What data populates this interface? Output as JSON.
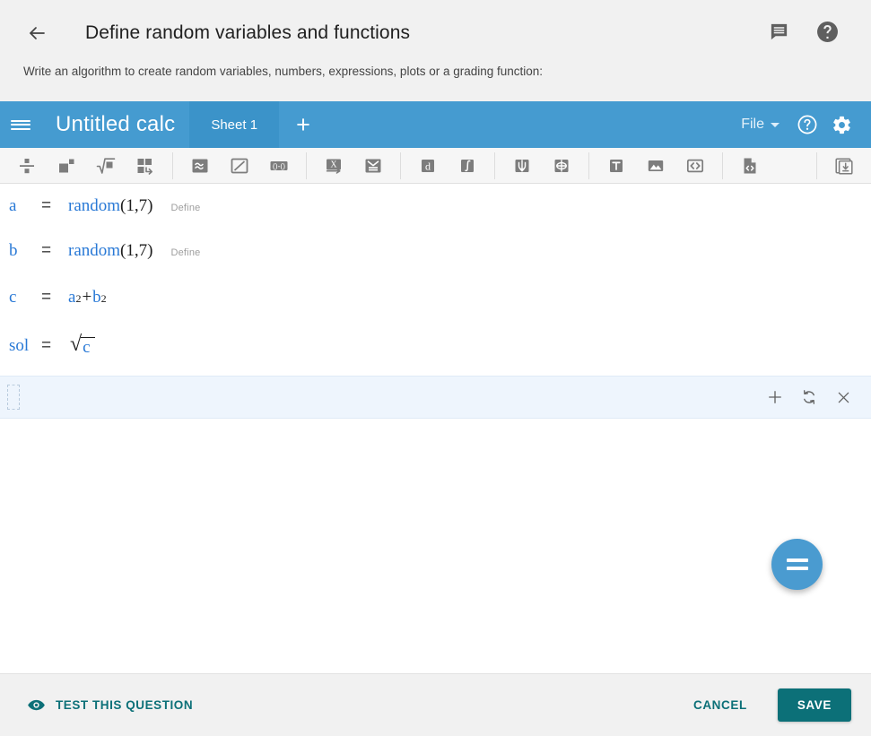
{
  "header": {
    "back_icon": "arrow-left-icon",
    "title": "Define random variables and functions",
    "subtitle": "Write an algorithm to create random variables, numbers, expressions, plots or a grading function:",
    "actions": [
      {
        "icon": "comment-icon",
        "name": "comment-icon"
      },
      {
        "icon": "help-circle-icon",
        "name": "help-icon"
      }
    ]
  },
  "appbar": {
    "menu_icon": "hamburger-menu-icon",
    "calc_title": "Untitled calc",
    "tabs": [
      {
        "label": "Sheet 1",
        "active": true
      }
    ],
    "add_tab_label": "+",
    "file_menu_label": "File",
    "help_icon": "help-circle-icon",
    "settings_icon": "gear-icon",
    "bg_color": "#459bd0",
    "active_tab_color": "#3b93c9"
  },
  "toolbar": {
    "groups": [
      {
        "buttons": [
          {
            "name": "fraction-icon",
            "title": "Fraction"
          },
          {
            "name": "exponent-icon",
            "title": "Exponent"
          },
          {
            "name": "square-root-icon",
            "title": "Square root"
          },
          {
            "name": "matrix-icon",
            "title": "Matrix"
          }
        ]
      },
      {
        "buttons": [
          {
            "name": "approx-equal-icon",
            "title": "Approximately equal"
          },
          {
            "name": "not-equal-icon",
            "title": "Not equal"
          },
          {
            "name": "interval-icon",
            "title": "Interval"
          }
        ]
      },
      {
        "buttons": [
          {
            "name": "substitute-icon",
            "title": "Substitute"
          },
          {
            "name": "system-equations-icon",
            "title": "System of equations"
          }
        ]
      },
      {
        "buttons": [
          {
            "name": "derivative-icon",
            "title": "Derivative"
          },
          {
            "name": "integral-icon",
            "title": "Integral"
          }
        ]
      },
      {
        "buttons": [
          {
            "name": "units-icon",
            "title": "Units"
          },
          {
            "name": "plot-units-icon",
            "title": "Plot"
          }
        ]
      },
      {
        "buttons": [
          {
            "name": "text-icon",
            "title": "Text"
          },
          {
            "name": "image-icon",
            "title": "Image"
          },
          {
            "name": "code-icon",
            "title": "Code"
          }
        ]
      },
      {
        "buttons": [
          {
            "name": "document-code-icon",
            "title": "Document code"
          }
        ]
      }
    ],
    "trailing_button": {
      "name": "save-sheet-icon",
      "title": "Save sheet"
    }
  },
  "sheet": {
    "rows": [
      {
        "var": "a",
        "eq": "=",
        "expr_kind": "function",
        "fn": "random",
        "args": "(1,7)",
        "tag": "Define"
      },
      {
        "var": "b",
        "eq": "=",
        "expr_kind": "function",
        "fn": "random",
        "args": "(1,7)",
        "tag": "Define"
      },
      {
        "var": "c",
        "eq": "=",
        "expr_kind": "power_sum",
        "base1": "a",
        "exp1": "2",
        "op": "+",
        "base2": "b",
        "exp2": "2",
        "tag": ""
      },
      {
        "var": "sol",
        "eq": "=",
        "expr_kind": "sqrt",
        "radicand": "c",
        "tag": ""
      }
    ],
    "active_row": {
      "placeholder": "",
      "actions": [
        {
          "name": "add-row-icon",
          "glyph": "+"
        },
        {
          "name": "refresh-icon",
          "glyph": "refresh"
        },
        {
          "name": "delete-row-icon",
          "glyph": "close"
        }
      ],
      "bg_color": "#eef5fd"
    },
    "fab": {
      "name": "evaluate-fab",
      "glyph": "=",
      "color": "#4a9bd0"
    }
  },
  "bottom_bar": {
    "test_label": "TEST THIS QUESTION",
    "test_icon": "eye-icon",
    "cancel_label": "CANCEL",
    "save_label": "SAVE",
    "accent_color": "#0c7078"
  }
}
